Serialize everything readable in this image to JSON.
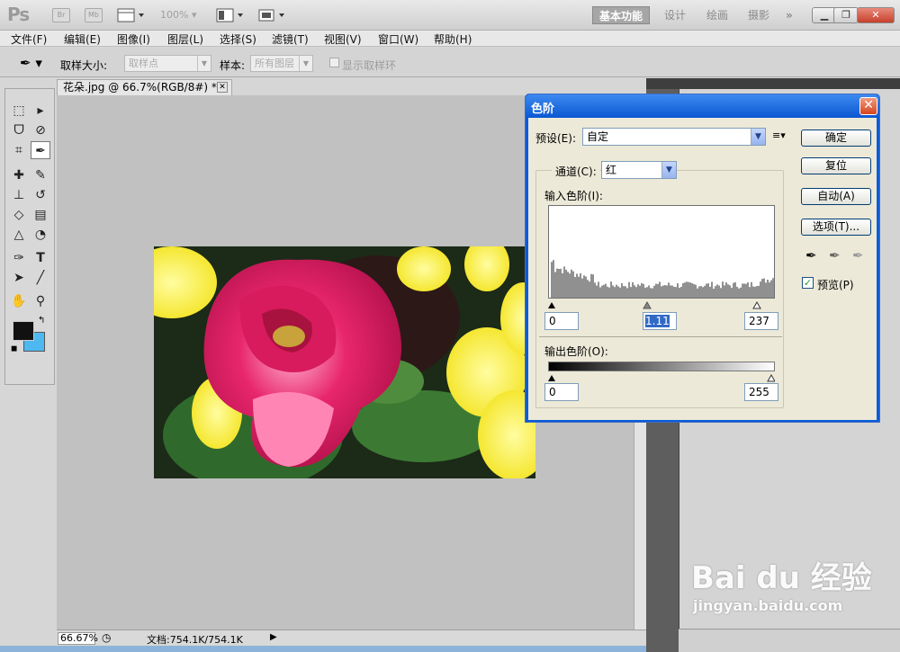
{
  "app": {
    "logo": "Ps",
    "zoom": "100%"
  },
  "toolbar_icons": [
    {
      "name": "bridge",
      "label": "Br"
    },
    {
      "name": "minibridge",
      "label": "Mb"
    }
  ],
  "workspaces": [
    "基本功能",
    "设计",
    "绘画",
    "摄影"
  ],
  "menus": [
    "文件(F)",
    "编辑(E)",
    "图像(I)",
    "图层(L)",
    "选择(S)",
    "滤镜(T)",
    "视图(V)",
    "窗口(W)",
    "帮助(H)"
  ],
  "options_bar": {
    "sample_size_label": "取样大小:",
    "sample_size_value": "取样点",
    "sample_label": "样本:",
    "sample_value": "所有图层",
    "show_ring_label": "显示取样环"
  },
  "document": {
    "tab_title": "花朵.jpg @ 66.7%(RGB/8#) *"
  },
  "status": {
    "zoom": "66.67%",
    "doc_info": "文档:754.1K/754.1K"
  },
  "levels_dialog": {
    "title": "色阶",
    "preset_label": "预设(E):",
    "preset_value": "自定",
    "channel_label": "通道(C):",
    "channel_value": "红",
    "input_levels_label": "输入色阶(I):",
    "input_black": "0",
    "input_gamma": "1.11",
    "input_white": "237",
    "output_levels_label": "输出色阶(O):",
    "output_black": "0",
    "output_white": "255",
    "buttons": {
      "ok": "确定",
      "reset": "复位",
      "auto": "自动(A)",
      "options": "选项(T)..."
    },
    "preview_label": "预览(P)",
    "preview_checked": true
  },
  "watermark": {
    "brand": "Bai du 经验",
    "url": "jingyan.baidu.com"
  }
}
